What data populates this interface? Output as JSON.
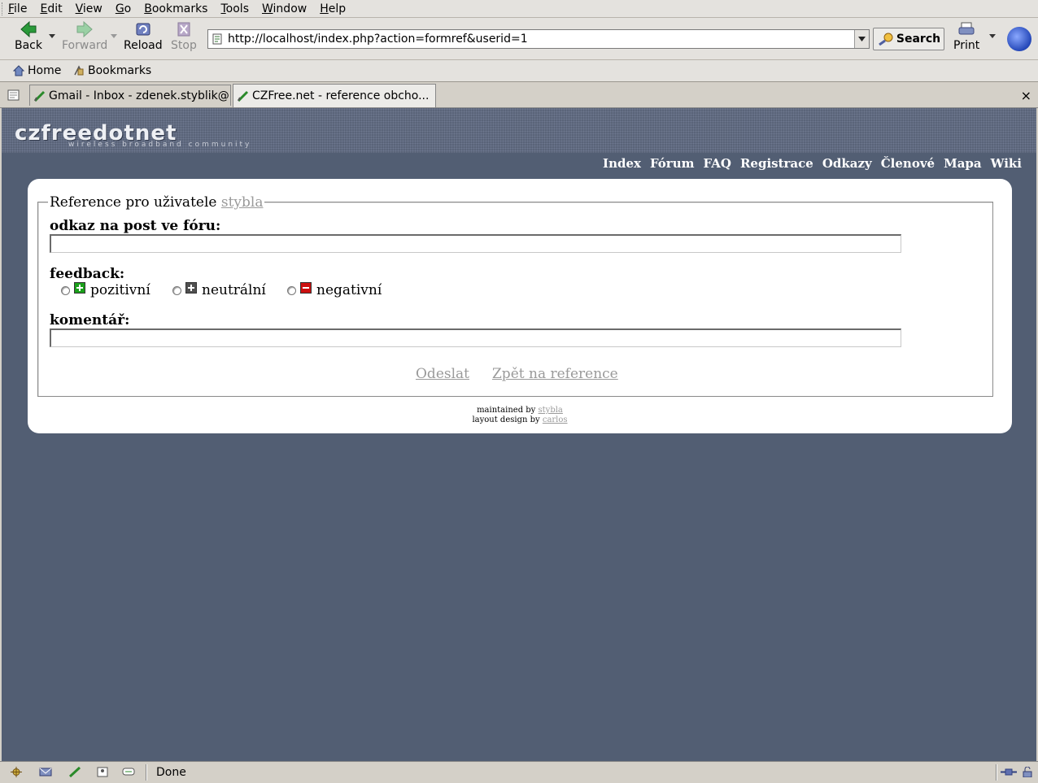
{
  "menu": [
    "File",
    "Edit",
    "View",
    "Go",
    "Bookmarks",
    "Tools",
    "Window",
    "Help"
  ],
  "toolbar": {
    "back": "Back",
    "forward": "Forward",
    "reload": "Reload",
    "stop": "Stop",
    "url": "http://localhost/index.php?action=formref&userid=1",
    "search": "Search",
    "print": "Print"
  },
  "personal_toolbar": {
    "home": "Home",
    "bookmarks": "Bookmarks"
  },
  "tabs": [
    {
      "label": "Gmail - Inbox - zdenek.styblik@...",
      "active": false
    },
    {
      "label": "CZFree.net - reference obcho...",
      "active": true
    }
  ],
  "tab_close": "×",
  "site": {
    "logo_main": "czfreedotnet",
    "logo_sub": "wireless broadband community",
    "nav": [
      "Index",
      "Fórum",
      "FAQ",
      "Registrace",
      "Odkazy",
      "Členové",
      "Mapa",
      "Wiki"
    ]
  },
  "form": {
    "legend_prefix": "Reference pro uživatele",
    "legend_user": "stybla",
    "post_label": "odkaz na post ve fóru:",
    "post_value": "",
    "feedback_label": "feedback:",
    "options": [
      {
        "label": "pozitivní",
        "icon": "plus-icon",
        "color": "#1aa01a"
      },
      {
        "label": "neutrální",
        "icon": "plus-icon",
        "color": "#505050"
      },
      {
        "label": "negativní",
        "icon": "minus-icon",
        "color": "#cc1010"
      }
    ],
    "comment_label": "komentář:",
    "comment_value": "",
    "submit": "Odeslat",
    "back": "Zpět na reference"
  },
  "footer": {
    "maintained_prefix": "maintained by",
    "maintained_name": "stybla",
    "layout_prefix": "layout design by",
    "layout_name": "carlos"
  },
  "status": "Done",
  "colors": {
    "page_bg": "#525e73",
    "link_gray": "#9a9a9a"
  }
}
